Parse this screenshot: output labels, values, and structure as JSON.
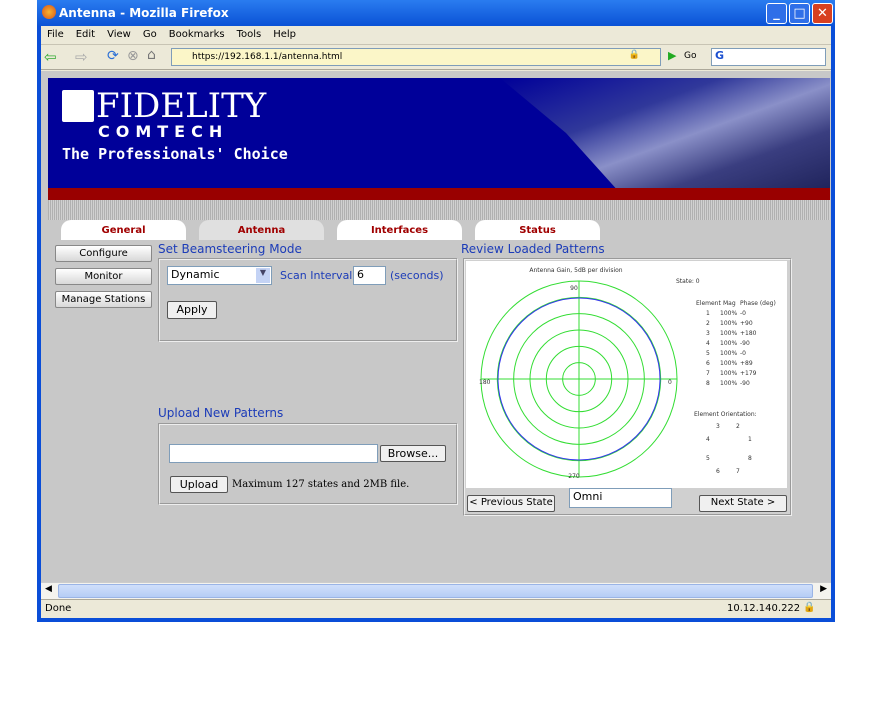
{
  "window": {
    "title": "Antenna - Mozilla Firefox"
  },
  "menu": [
    "File",
    "Edit",
    "View",
    "Go",
    "Bookmarks",
    "Tools",
    "Help"
  ],
  "nav": {
    "url": "https://192.168.1.1/antenna.html",
    "go_label": "Go",
    "search_logo": "G"
  },
  "header": {
    "logo_line1": "FIDELITY",
    "logo_line2": "COMTECH",
    "tagline": "The Professionals' Choice"
  },
  "tabs": [
    {
      "label": "General"
    },
    {
      "label": "Antenna",
      "active": true
    },
    {
      "label": "Interfaces"
    },
    {
      "label": "Status"
    }
  ],
  "sidebar": [
    "Configure",
    "Monitor",
    "Manage Stations"
  ],
  "beam": {
    "title": "Set Beamsteering Mode",
    "mode": "Dynamic",
    "scan_label": "Scan Interval",
    "scan_value": "6",
    "unit": "(seconds)",
    "apply": "Apply"
  },
  "upload": {
    "title": "Upload New Patterns",
    "file_value": "",
    "browse": "Browse...",
    "upload": "Upload",
    "note": "Maximum 127 states and 2MB file."
  },
  "review": {
    "title": "Review Loaded Patterns",
    "prev": "< Previous State",
    "next": "Next State >",
    "state_name": "Omni"
  },
  "plot": {
    "title": "Antenna Gain, 5dB per division",
    "state": "State: 0",
    "angle_labels": {
      "top": "90",
      "left": "180",
      "right": "0",
      "bottom": "270"
    },
    "table_header": [
      "Element",
      "Mag",
      "Phase (deg)"
    ],
    "elements": [
      [
        "1",
        "100%",
        "-0"
      ],
      [
        "2",
        "100%",
        "+90"
      ],
      [
        "3",
        "100%",
        "+180"
      ],
      [
        "4",
        "100%",
        "-90"
      ],
      [
        "5",
        "100%",
        "-0"
      ],
      [
        "6",
        "100%",
        "+89"
      ],
      [
        "7",
        "100%",
        "+179"
      ],
      [
        "8",
        "100%",
        "-90"
      ]
    ],
    "orientation_title": "Element Orientation:",
    "colors": {
      "grid": "#33dd33",
      "pattern": "#3333ee"
    }
  },
  "statusbar": {
    "text": "Done",
    "ip": "10.12.140.222"
  }
}
